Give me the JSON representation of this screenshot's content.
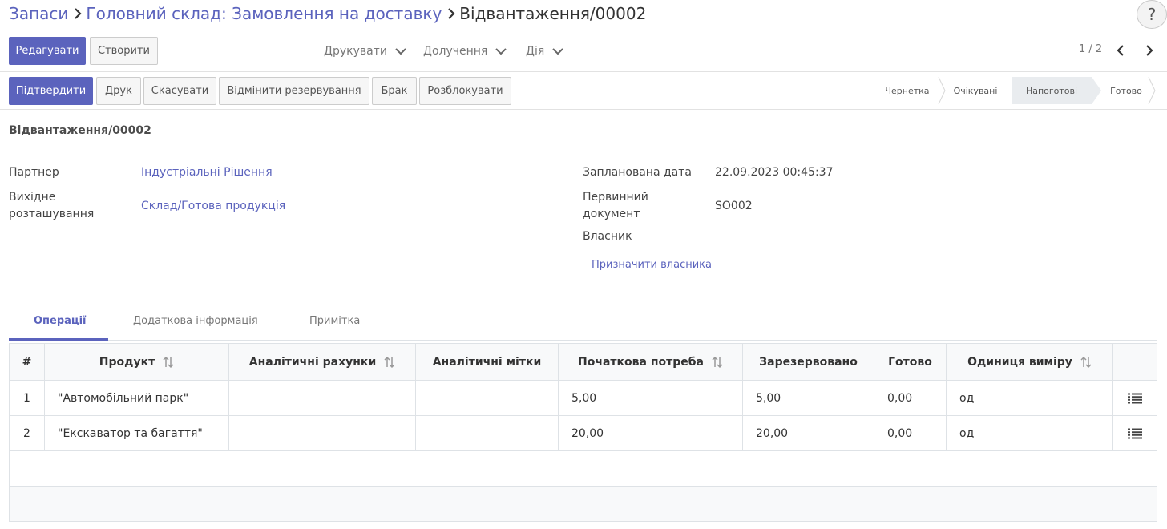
{
  "breadcrumb": {
    "items": [
      "Запаси",
      "Головний склад: Замовлення на доставку"
    ],
    "current": "Відвантаження/00002"
  },
  "help_label": "?",
  "toolbar": {
    "edit_label": "Редагувати",
    "create_label": "Створити",
    "print_label": "Друкувати",
    "attachments_label": "Долучення",
    "action_label": "Дія",
    "pager": "1 / 2"
  },
  "actions": {
    "confirm_label": "Підтвердити",
    "print_label": "Друк",
    "cancel_label": "Скасувати",
    "unreserve_label": "Відмінити резервування",
    "scrap_label": "Брак",
    "unlock_label": "Розблокувати"
  },
  "statusbar": {
    "stages": [
      "Чернетка",
      "Очікувані",
      "Напоготові",
      "Готово"
    ],
    "active": "Напоготові"
  },
  "form": {
    "title": "Відвантаження/00002",
    "partner_label": "Партнер",
    "partner_value": "Індустріальні Рішення",
    "source_location_label": "Вихідне розташування",
    "source_location_value": "Склад/Готова продукція",
    "scheduled_date_label": "Запланована дата",
    "scheduled_date_value": "22.09.2023 00:45:37",
    "source_document_label": "Первинний документ",
    "source_document_value": "SO002",
    "owner_label": "Власник",
    "assign_owner_label": "Призначити власника"
  },
  "tabs": [
    "Операції",
    "Додаткова інформація",
    "Примітка"
  ],
  "table": {
    "columns": [
      "#",
      "Продукт",
      "Аналітичні рахунки",
      "Аналітичні мітки",
      "Початкова потреба",
      "Зарезервовано",
      "Готово",
      "Одиниця виміру"
    ],
    "rows": [
      {
        "num": "1",
        "product": "\"Автомобільний парк\"",
        "accounts": "",
        "tags": "",
        "demand": "5,00",
        "reserved": "5,00",
        "done": "0,00",
        "uom": "од"
      },
      {
        "num": "2",
        "product": "\"Екскаватор та багаття\"",
        "accounts": "",
        "tags": "",
        "demand": "20,00",
        "reserved": "20,00",
        "done": "0,00",
        "uom": "од"
      }
    ]
  },
  "colors": {
    "primary": "#5b63bd",
    "link": "#5b63bd",
    "active_stage": "#e9ecef"
  }
}
